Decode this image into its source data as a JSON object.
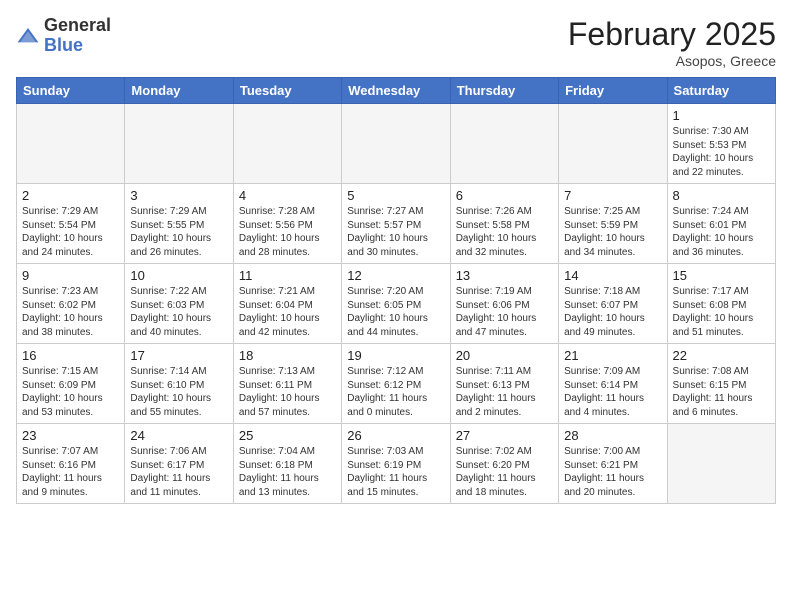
{
  "header": {
    "logo_general": "General",
    "logo_blue": "Blue",
    "month_title": "February 2025",
    "subtitle": "Asopos, Greece"
  },
  "days_of_week": [
    "Sunday",
    "Monday",
    "Tuesday",
    "Wednesday",
    "Thursday",
    "Friday",
    "Saturday"
  ],
  "weeks": [
    [
      {
        "day": "",
        "info": ""
      },
      {
        "day": "",
        "info": ""
      },
      {
        "day": "",
        "info": ""
      },
      {
        "day": "",
        "info": ""
      },
      {
        "day": "",
        "info": ""
      },
      {
        "day": "",
        "info": ""
      },
      {
        "day": "1",
        "info": "Sunrise: 7:30 AM\nSunset: 5:53 PM\nDaylight: 10 hours\nand 22 minutes."
      }
    ],
    [
      {
        "day": "2",
        "info": "Sunrise: 7:29 AM\nSunset: 5:54 PM\nDaylight: 10 hours\nand 24 minutes."
      },
      {
        "day": "3",
        "info": "Sunrise: 7:29 AM\nSunset: 5:55 PM\nDaylight: 10 hours\nand 26 minutes."
      },
      {
        "day": "4",
        "info": "Sunrise: 7:28 AM\nSunset: 5:56 PM\nDaylight: 10 hours\nand 28 minutes."
      },
      {
        "day": "5",
        "info": "Sunrise: 7:27 AM\nSunset: 5:57 PM\nDaylight: 10 hours\nand 30 minutes."
      },
      {
        "day": "6",
        "info": "Sunrise: 7:26 AM\nSunset: 5:58 PM\nDaylight: 10 hours\nand 32 minutes."
      },
      {
        "day": "7",
        "info": "Sunrise: 7:25 AM\nSunset: 5:59 PM\nDaylight: 10 hours\nand 34 minutes."
      },
      {
        "day": "8",
        "info": "Sunrise: 7:24 AM\nSunset: 6:01 PM\nDaylight: 10 hours\nand 36 minutes."
      }
    ],
    [
      {
        "day": "9",
        "info": "Sunrise: 7:23 AM\nSunset: 6:02 PM\nDaylight: 10 hours\nand 38 minutes."
      },
      {
        "day": "10",
        "info": "Sunrise: 7:22 AM\nSunset: 6:03 PM\nDaylight: 10 hours\nand 40 minutes."
      },
      {
        "day": "11",
        "info": "Sunrise: 7:21 AM\nSunset: 6:04 PM\nDaylight: 10 hours\nand 42 minutes."
      },
      {
        "day": "12",
        "info": "Sunrise: 7:20 AM\nSunset: 6:05 PM\nDaylight: 10 hours\nand 44 minutes."
      },
      {
        "day": "13",
        "info": "Sunrise: 7:19 AM\nSunset: 6:06 PM\nDaylight: 10 hours\nand 47 minutes."
      },
      {
        "day": "14",
        "info": "Sunrise: 7:18 AM\nSunset: 6:07 PM\nDaylight: 10 hours\nand 49 minutes."
      },
      {
        "day": "15",
        "info": "Sunrise: 7:17 AM\nSunset: 6:08 PM\nDaylight: 10 hours\nand 51 minutes."
      }
    ],
    [
      {
        "day": "16",
        "info": "Sunrise: 7:15 AM\nSunset: 6:09 PM\nDaylight: 10 hours\nand 53 minutes."
      },
      {
        "day": "17",
        "info": "Sunrise: 7:14 AM\nSunset: 6:10 PM\nDaylight: 10 hours\nand 55 minutes."
      },
      {
        "day": "18",
        "info": "Sunrise: 7:13 AM\nSunset: 6:11 PM\nDaylight: 10 hours\nand 57 minutes."
      },
      {
        "day": "19",
        "info": "Sunrise: 7:12 AM\nSunset: 6:12 PM\nDaylight: 11 hours\nand 0 minutes."
      },
      {
        "day": "20",
        "info": "Sunrise: 7:11 AM\nSunset: 6:13 PM\nDaylight: 11 hours\nand 2 minutes."
      },
      {
        "day": "21",
        "info": "Sunrise: 7:09 AM\nSunset: 6:14 PM\nDaylight: 11 hours\nand 4 minutes."
      },
      {
        "day": "22",
        "info": "Sunrise: 7:08 AM\nSunset: 6:15 PM\nDaylight: 11 hours\nand 6 minutes."
      }
    ],
    [
      {
        "day": "23",
        "info": "Sunrise: 7:07 AM\nSunset: 6:16 PM\nDaylight: 11 hours\nand 9 minutes."
      },
      {
        "day": "24",
        "info": "Sunrise: 7:06 AM\nSunset: 6:17 PM\nDaylight: 11 hours\nand 11 minutes."
      },
      {
        "day": "25",
        "info": "Sunrise: 7:04 AM\nSunset: 6:18 PM\nDaylight: 11 hours\nand 13 minutes."
      },
      {
        "day": "26",
        "info": "Sunrise: 7:03 AM\nSunset: 6:19 PM\nDaylight: 11 hours\nand 15 minutes."
      },
      {
        "day": "27",
        "info": "Sunrise: 7:02 AM\nSunset: 6:20 PM\nDaylight: 11 hours\nand 18 minutes."
      },
      {
        "day": "28",
        "info": "Sunrise: 7:00 AM\nSunset: 6:21 PM\nDaylight: 11 hours\nand 20 minutes."
      },
      {
        "day": "",
        "info": ""
      }
    ]
  ]
}
